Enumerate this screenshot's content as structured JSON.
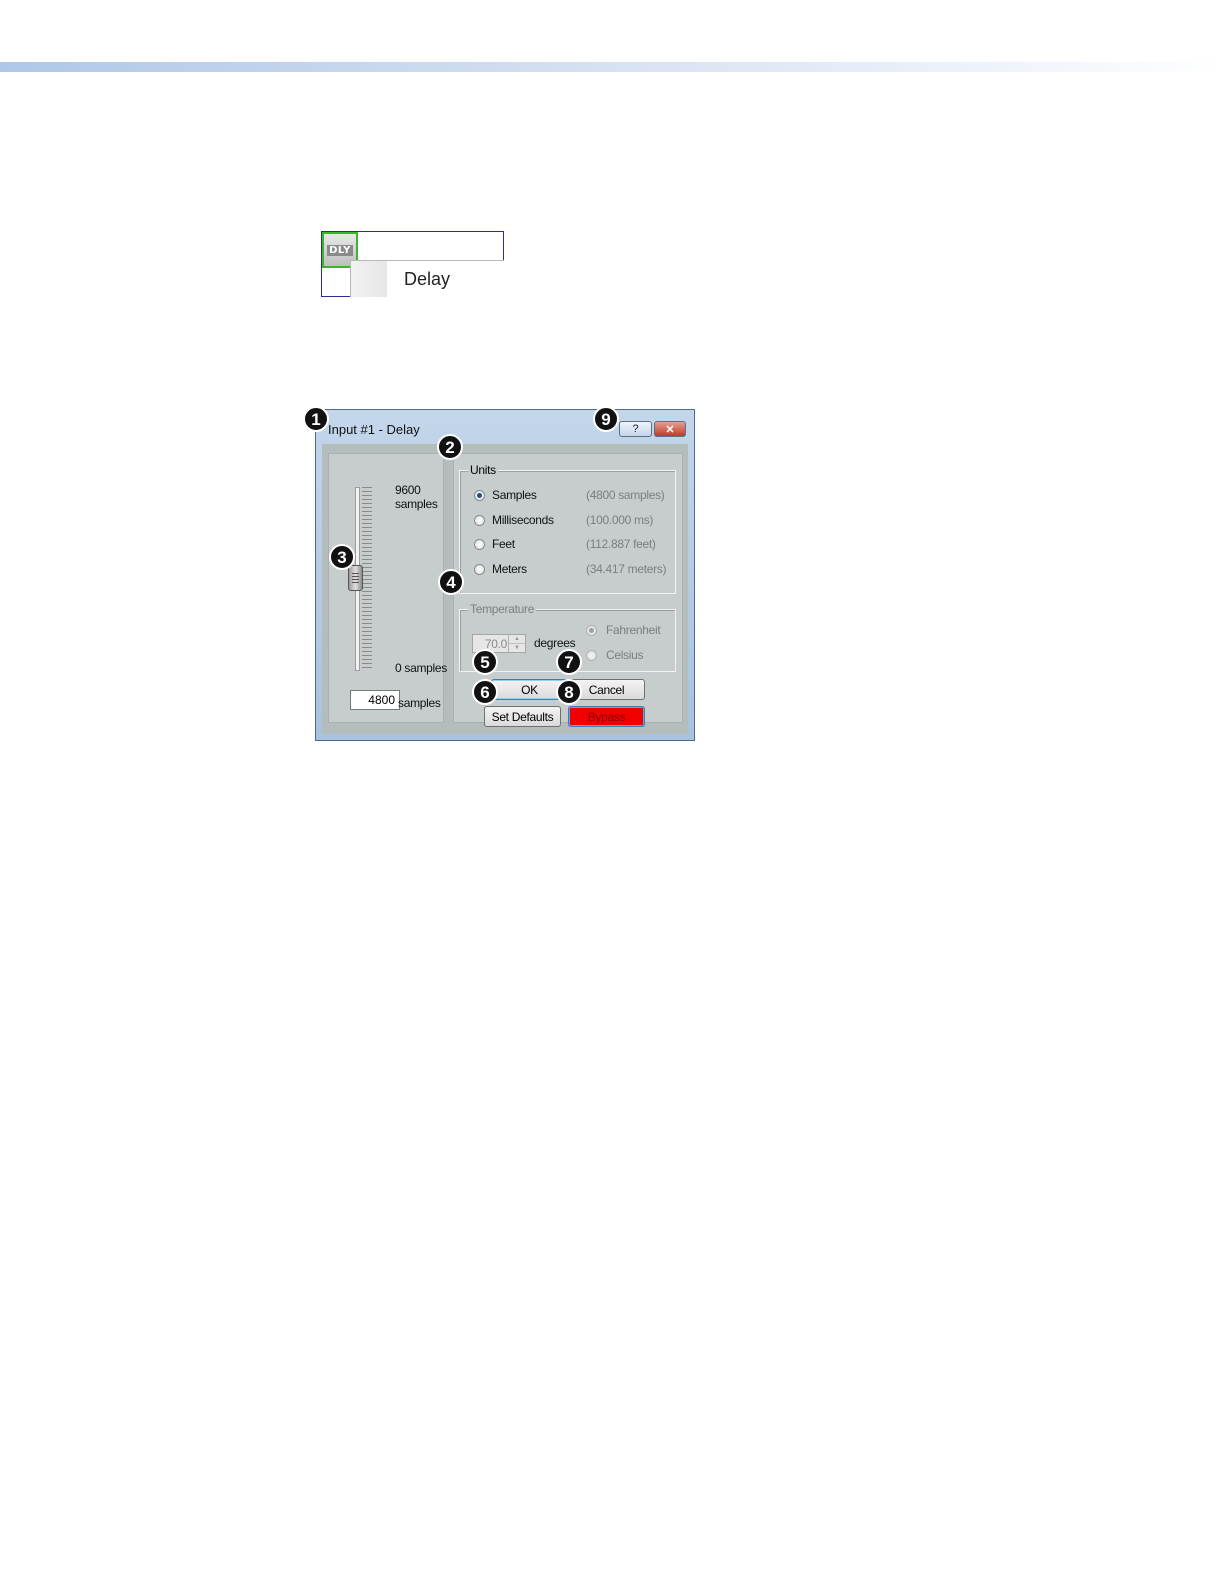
{
  "snippet": {
    "icon_label": "DLY",
    "menu_item_label": "Delay"
  },
  "dialog": {
    "title": "Input #1 - Delay",
    "help_label": "?",
    "close_label": "✕",
    "slider": {
      "max_value": "9600",
      "max_unit": "samples",
      "min_label": "0 samples",
      "current_value": "4800",
      "current_unit": "samples",
      "level_fraction": 0.5
    },
    "units": {
      "legend": "Units",
      "options": [
        {
          "label": "Samples",
          "value": "(4800 samples)",
          "checked": true
        },
        {
          "label": "Milliseconds",
          "value": "(100.000 ms)",
          "checked": false
        },
        {
          "label": "Feet",
          "value": "(112.887 feet)",
          "checked": false
        },
        {
          "label": "Meters",
          "value": "(34.417 meters)",
          "checked": false
        }
      ]
    },
    "temperature": {
      "legend": "Temperature",
      "value": "70.0",
      "unit_label": "degrees",
      "fahrenheit_label": "Fahrenheit",
      "celsius_label": "Celsius"
    },
    "buttons": {
      "ok": "OK",
      "cancel": "Cancel",
      "set_defaults": "Set Defaults",
      "bypass": "Bypass"
    },
    "bypass_color": "#f00000"
  },
  "callouts": [
    "1",
    "2",
    "3",
    "4",
    "5",
    "6",
    "7",
    "8",
    "9"
  ]
}
